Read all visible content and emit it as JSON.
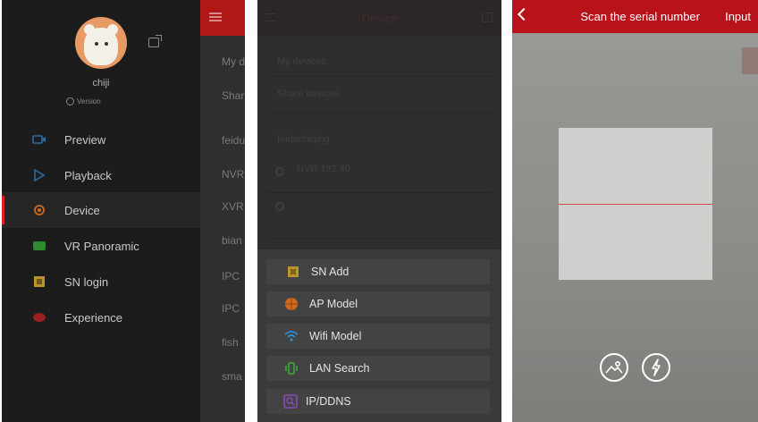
{
  "panel1": {
    "username": "chiji",
    "version_label": "Version",
    "nav_items": [
      {
        "label": "Preview",
        "icon": "camera-icon",
        "color": "#2f6aa0"
      },
      {
        "label": "Playback",
        "icon": "playback-icon",
        "color": "#2f6aa0"
      },
      {
        "label": "Device",
        "icon": "device-gear-icon",
        "color": "#d16a1e",
        "active": true
      },
      {
        "label": "VR Panoramic",
        "icon": "vr-panoramic-icon",
        "color": "#2f8a2f"
      },
      {
        "label": "SN login",
        "icon": "sn-login-icon",
        "color": "#b8952a"
      },
      {
        "label": "Experience",
        "icon": "experience-icon",
        "color": "#9a2020"
      }
    ],
    "background_list": [
      "My d",
      "Shar",
      "feidu",
      "NVR",
      "XVR",
      "bian",
      "IPC",
      "IPC",
      "fish",
      "sma"
    ]
  },
  "panel2": {
    "title": "Device",
    "dim_rows": [
      "My devices",
      "Share devices",
      "feiduchiqing",
      "NVR 192.40",
      "",
      ""
    ],
    "sheet_buttons": [
      {
        "label": "SN Add",
        "icon": "sn-add-icon",
        "color": "#b8952a"
      },
      {
        "label": "AP Model",
        "icon": "ap-globe-icon",
        "color": "#d16a1e"
      },
      {
        "label": "Wifi Model",
        "icon": "wifi-icon",
        "color": "#2f8fd6"
      },
      {
        "label": "LAN Search",
        "icon": "lan-search-icon",
        "color": "#3aa83a"
      },
      {
        "label": "IP/DDNS",
        "icon": "ip-ddns-icon",
        "color": "#8a4ab8"
      }
    ]
  },
  "panel3": {
    "title": "Scan the serial number",
    "input_label": "Input",
    "accent": "#b8121a"
  }
}
